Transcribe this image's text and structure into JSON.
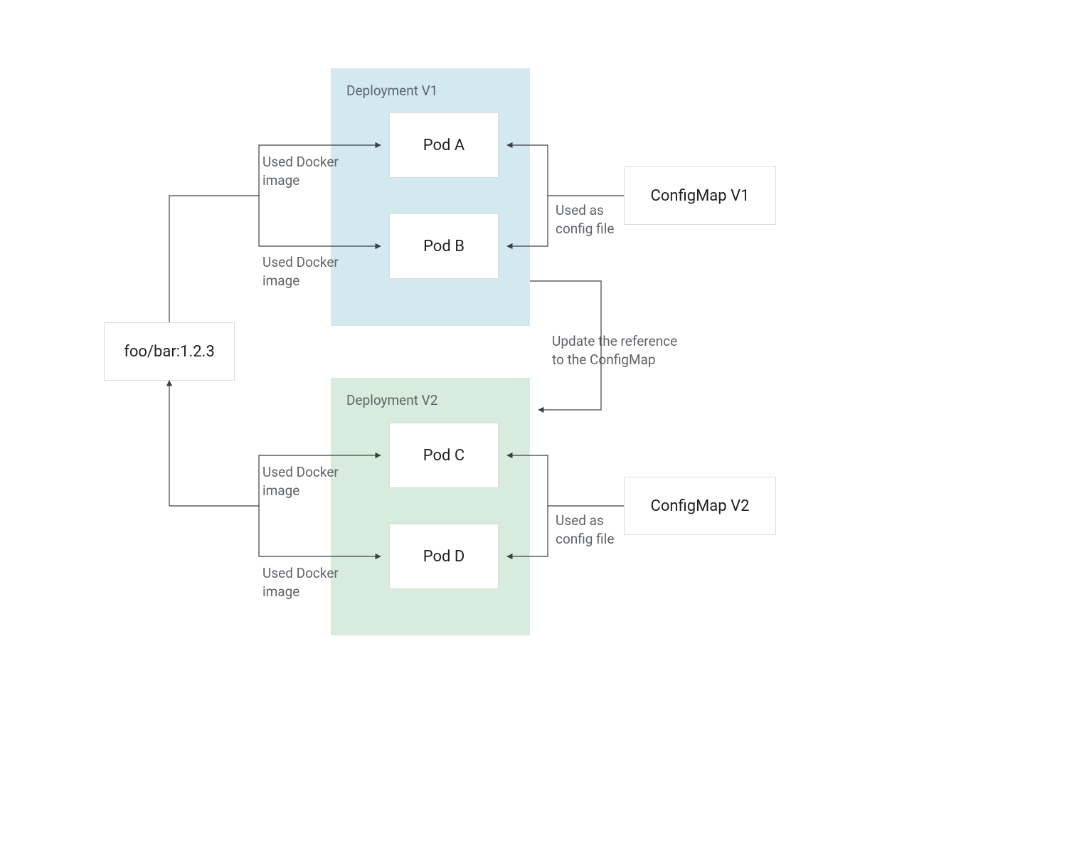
{
  "dockerImage": {
    "label": "foo/bar:1.2.3"
  },
  "deployments": {
    "v1": {
      "title": "Deployment V1",
      "pods": {
        "a": "Pod A",
        "b": "Pod B"
      },
      "color": "#d2e9f0"
    },
    "v2": {
      "title": "Deployment V2",
      "pods": {
        "c": "Pod C",
        "d": "Pod D"
      },
      "color": "#d7ecdc"
    }
  },
  "configMaps": {
    "v1": "ConfigMap V1",
    "v2": "ConfigMap V2"
  },
  "edgeLabels": {
    "dockerA": "Used Docker\nimage",
    "dockerB": "Used Docker\nimage",
    "dockerC": "Used Docker\nimage",
    "dockerD": "Used Docker\nimage",
    "configV1": "Used as\nconfig file",
    "configV2": "Used as\nconfig file",
    "updateRef": "Update the reference\nto the ConfigMap"
  }
}
